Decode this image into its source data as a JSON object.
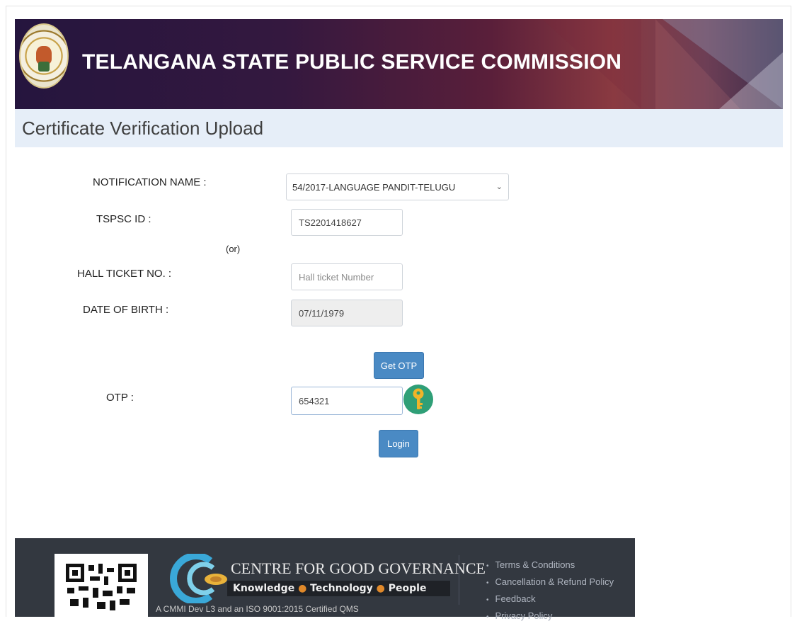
{
  "header": {
    "org_title": "TELANGANA STATE PUBLIC SERVICE COMMISSION"
  },
  "page": {
    "title": "Certificate Verification Upload"
  },
  "form": {
    "notification_label": "NOTIFICATION NAME :",
    "notification_value": "54/2017-LANGUAGE PANDIT-TELUGU",
    "tspsc_id_label": "TSPSC ID :",
    "tspsc_id_value": "TS2201418627",
    "or_text": "(or)",
    "hall_ticket_label": "HALL TICKET NO. :",
    "hall_ticket_placeholder": "Hall ticket Number",
    "dob_label": "DATE OF BIRTH :",
    "dob_value": "07/11/1979",
    "get_otp_label": "Get OTP",
    "otp_label": "OTP :",
    "otp_value": "654321",
    "login_label": "Login"
  },
  "footer": {
    "org_name": "CENTRE FOR GOOD GOVERNANCE",
    "tagline": {
      "part1": "Knowledge",
      "part2": "Technology",
      "part3": "People"
    },
    "certification": "A CMMI Dev L3 and an ISO 9001:2015 Certified QMS",
    "links": [
      "Terms & Conditions",
      "Cancellation & Refund Policy",
      "Feedback",
      "Privacy Policy"
    ]
  },
  "colors": {
    "primary_button": "#4a8ac4",
    "key_badge": "#2f9f77",
    "footer_bg": "#333840",
    "title_bar_bg": "#e6eef8"
  },
  "icons": {
    "logo": "tspsc-emblem-icon",
    "otp_key": "key-icon",
    "qr": "qr-code-icon",
    "cgg": "cgg-logo-icon"
  }
}
